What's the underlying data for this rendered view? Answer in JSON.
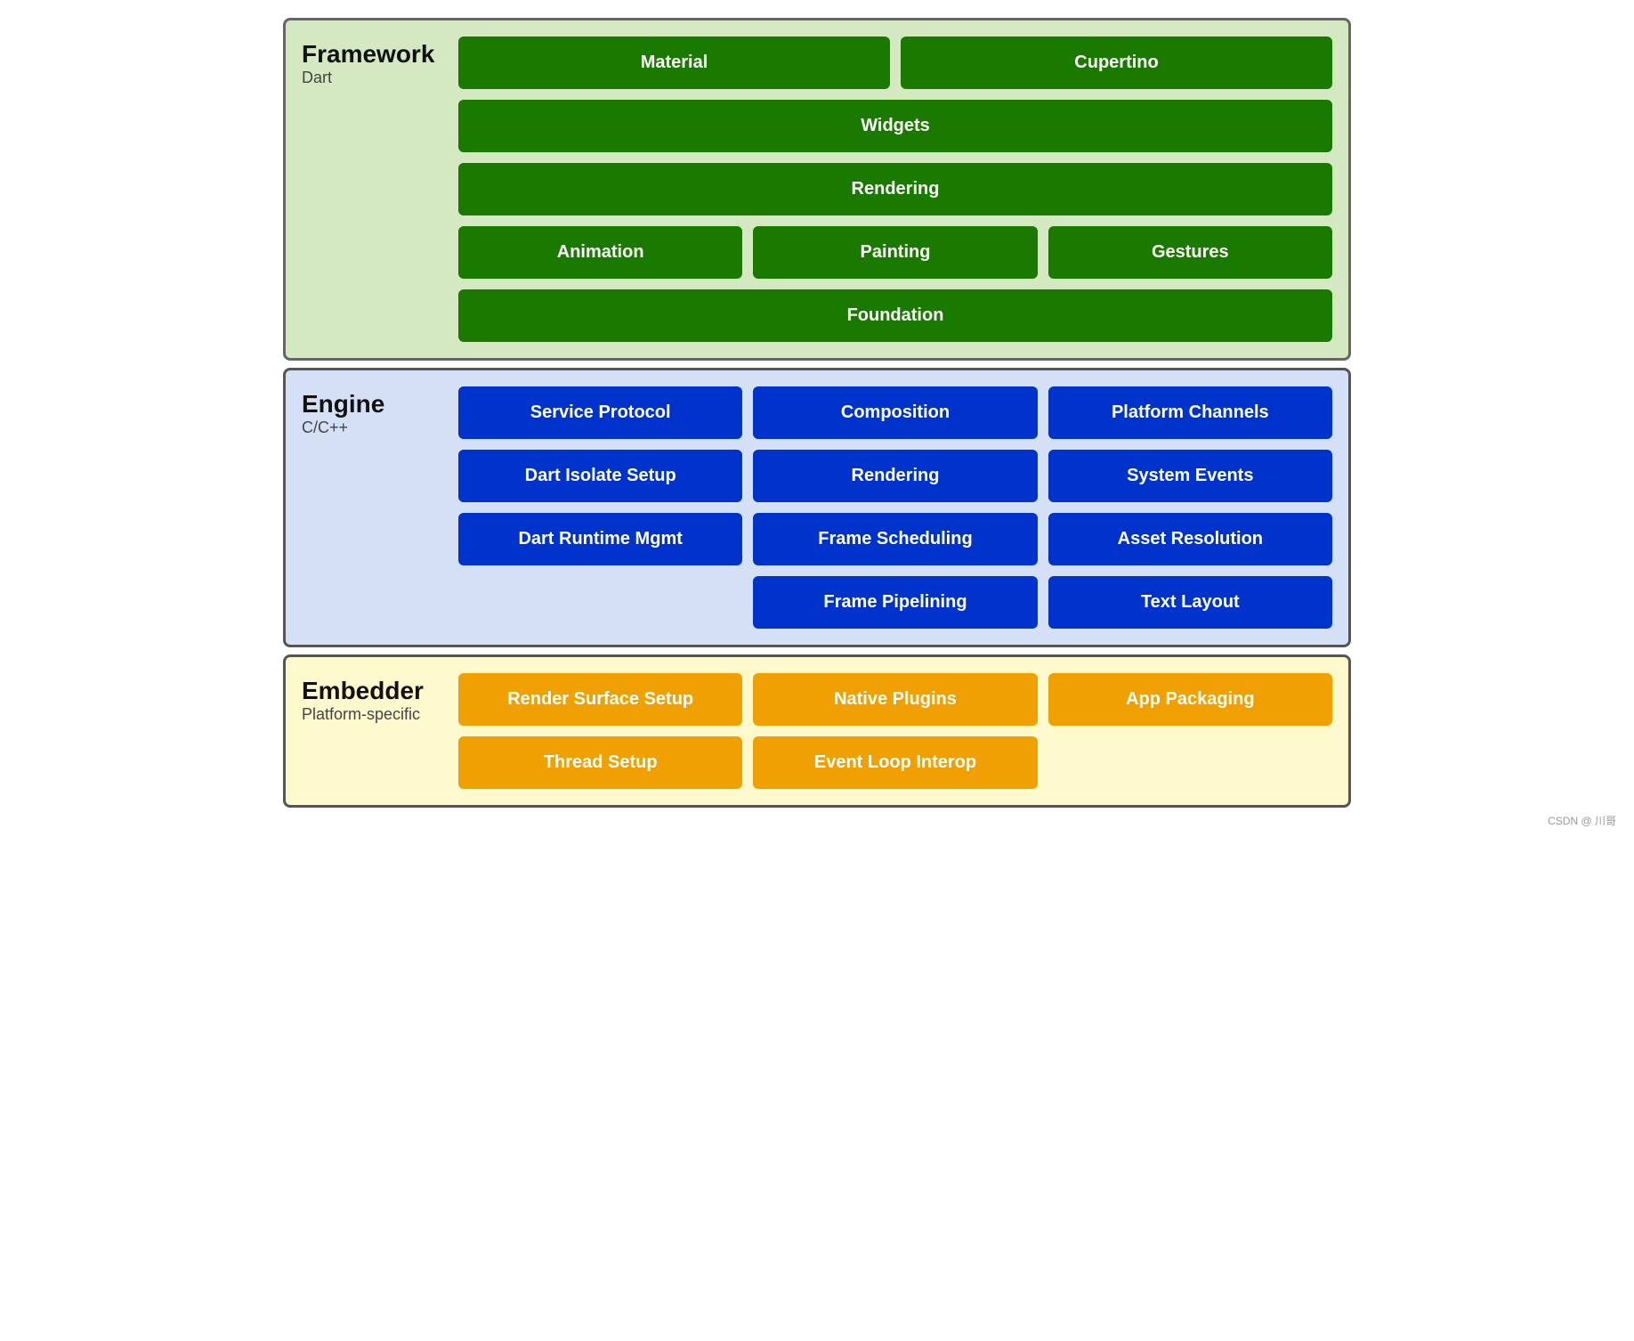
{
  "framework": {
    "title": "Framework",
    "subtitle": "Dart",
    "rows": [
      [
        "Material",
        "Cupertino"
      ],
      [
        "Widgets"
      ],
      [
        "Rendering"
      ],
      [
        "Animation",
        "Painting",
        "Gestures"
      ],
      [
        "Foundation"
      ]
    ]
  },
  "engine": {
    "title": "Engine",
    "subtitle": "C/C++",
    "rows": [
      [
        "Service Protocol",
        "Composition",
        "Platform Channels"
      ],
      [
        "Dart Isolate Setup",
        "Rendering",
        "System Events"
      ],
      [
        "Dart Runtime Mgmt",
        "Frame Scheduling",
        "Asset Resolution"
      ],
      [
        "",
        "Frame Pipelining",
        "Text Layout"
      ]
    ]
  },
  "embedder": {
    "title": "Embedder",
    "subtitle": "Platform-specific",
    "rows": [
      [
        "Render Surface Setup",
        "Native Plugins",
        "App Packaging"
      ],
      [
        "Thread Setup",
        "Event Loop Interop"
      ]
    ]
  },
  "watermark": "CSDN @ 川哥"
}
